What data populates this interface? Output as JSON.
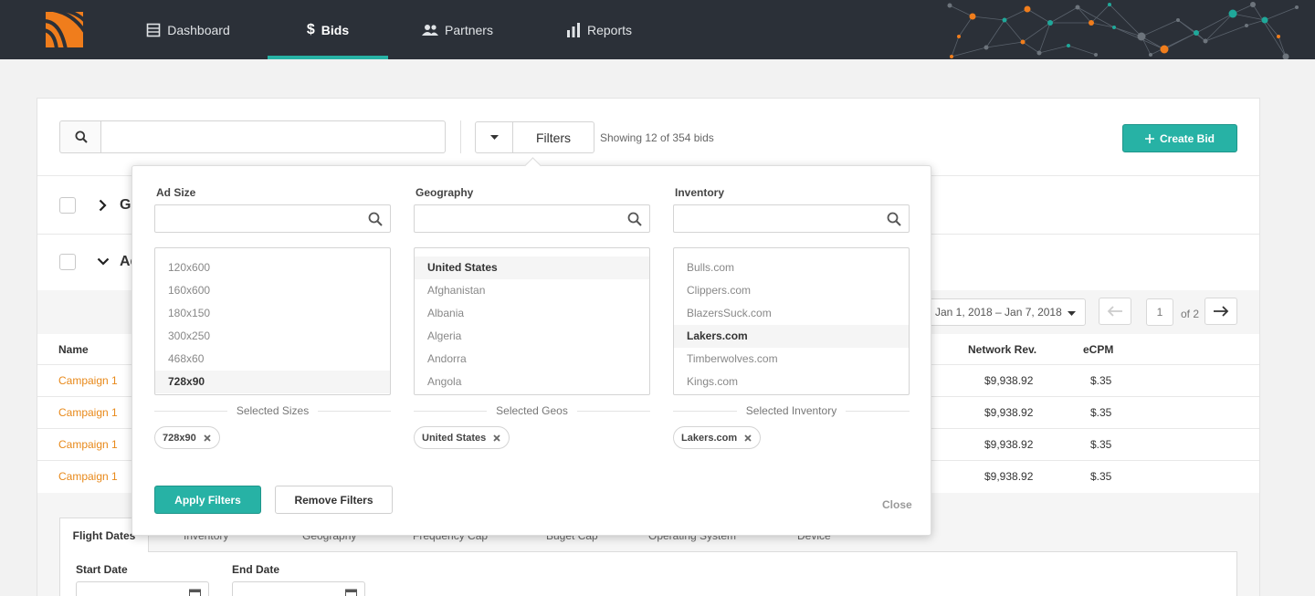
{
  "nav": {
    "items": [
      {
        "label": "Dashboard",
        "icon": "dashboard-icon"
      },
      {
        "label": "Bids",
        "icon": "dollar-icon",
        "active": true
      },
      {
        "label": "Partners",
        "icon": "people-icon"
      },
      {
        "label": "Reports",
        "icon": "bar-chart-icon"
      }
    ]
  },
  "colors": {
    "accent": "#27b2a5",
    "topbar": "#2b3038",
    "link": "#e8891a",
    "network_orange": "#f07d1c",
    "network_teal": "#1fa89a"
  },
  "toolbar": {
    "search_placeholder": "",
    "filters_label": "Filters",
    "showing_text": "Showing 12 of 354 bids",
    "create_label": "Create Bid"
  },
  "groups": [
    {
      "label": "Ge",
      "expanded": false
    },
    {
      "label": "Ad",
      "expanded": true
    }
  ],
  "date_range": {
    "label": "Jan 1, 2018 – Jan 7, 2018"
  },
  "pagination": {
    "current": "1",
    "of_text": "of 2"
  },
  "table": {
    "headers": {
      "name": "Name",
      "network_rev": "Network Rev.",
      "ecpm": "eCPM"
    },
    "rows": [
      {
        "name": "Campaign 1",
        "network_rev": "$9,938.92",
        "ecpm": "$.35"
      },
      {
        "name": "Campaign 1",
        "network_rev": "$9,938.92",
        "ecpm": "$.35"
      },
      {
        "name": "Campaign 1",
        "network_rev": "$9,938.92",
        "ecpm": "$.35"
      },
      {
        "name": "Campaign 1",
        "network_rev": "$9,938.92",
        "ecpm": "$.35"
      }
    ]
  },
  "detail": {
    "tabs": [
      "Flight Dates",
      "Inventory",
      "Geography",
      "Frequency Cap",
      "Buget Cap",
      "Operating System",
      "Device"
    ],
    "start_label": "Start Date",
    "end_label": "End Date"
  },
  "filters": {
    "ad_size": {
      "title": "Ad Size",
      "items": [
        "120x600",
        "160x600",
        "180x150",
        "300x250",
        "468x60",
        "728x90"
      ],
      "selected_label": "Selected Sizes",
      "chip": "728x90"
    },
    "geography": {
      "title": "Geography",
      "items": [
        "United States",
        "Afghanistan",
        "Albania",
        "Algeria",
        "Andorra",
        "Angola"
      ],
      "selected_label": "Selected Geos",
      "chip": "United States"
    },
    "inventory": {
      "title": "Inventory",
      "items": [
        "Bulls.com",
        "Clippers.com",
        "BlazersSuck.com",
        "Lakers.com",
        "Timberwolves.com",
        "Kings.com"
      ],
      "selected_label": "Selected Inventory",
      "chip": "Lakers.com"
    },
    "apply_label": "Apply Filters",
    "remove_label": "Remove Filters",
    "close_label": "Close"
  }
}
